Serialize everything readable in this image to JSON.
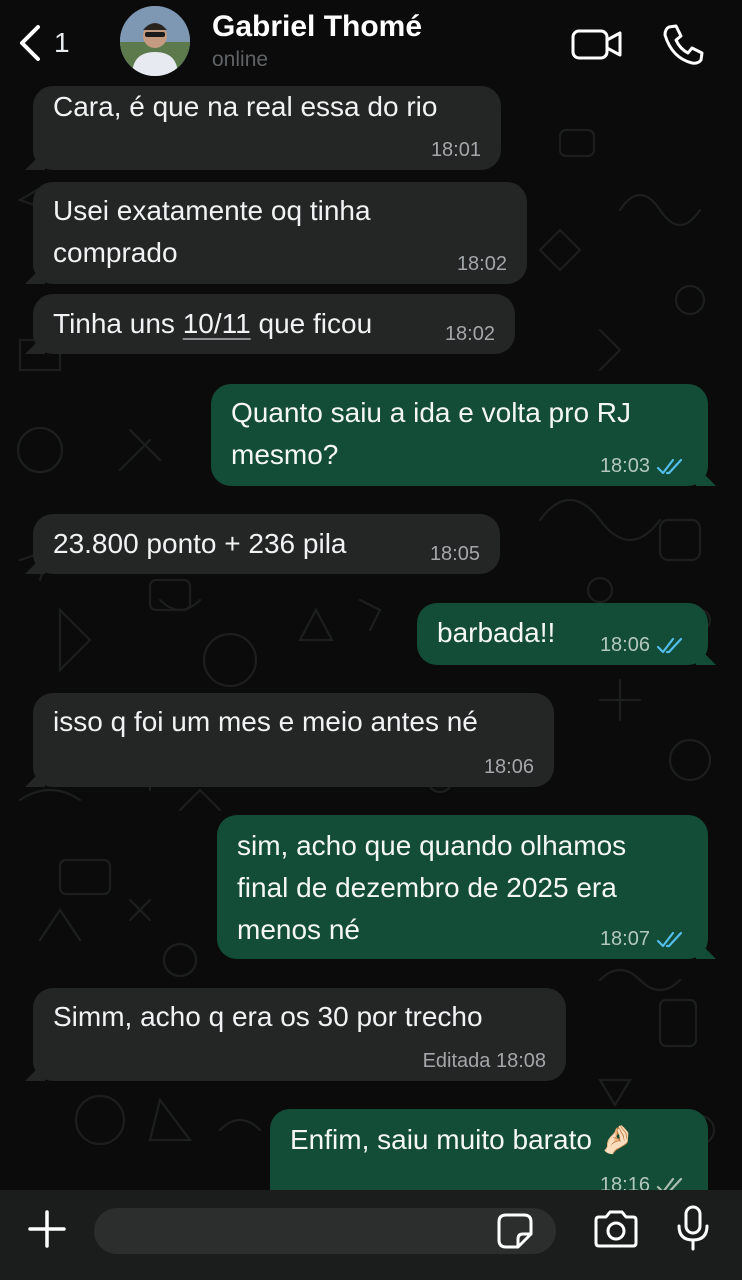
{
  "header": {
    "back_count": "1",
    "contact_name": "Gabriel Thomé",
    "status": "online"
  },
  "messages": [
    {
      "direction": "in",
      "text": "Cara, é que na real essa do rio",
      "time": "18:01"
    },
    {
      "direction": "in",
      "lines": [
        "Usei exatamente oq tinha",
        "comprado"
      ],
      "time": "18:02"
    },
    {
      "direction": "in",
      "text_before": "Tinha uns ",
      "link": "10/11",
      "text_after": " que ficou",
      "time": "18:02"
    },
    {
      "direction": "out",
      "lines": [
        "Quanto saiu a ida e volta pro RJ",
        "mesmo?"
      ],
      "time": "18:03",
      "read": true
    },
    {
      "direction": "in",
      "text": "23.800 ponto + 236 pila",
      "time": "18:05"
    },
    {
      "direction": "out",
      "text": "barbada!!",
      "time": "18:06",
      "read": true
    },
    {
      "direction": "in",
      "text": "isso q foi um mes e meio antes né",
      "time": "18:06"
    },
    {
      "direction": "out",
      "lines": [
        "sim, acho que quando olhamos",
        "final de dezembro de 2025 era",
        "menos né"
      ],
      "time": "18:07",
      "read": true
    },
    {
      "direction": "in",
      "text": "Simm, acho q era os 30 por trecho",
      "time": "Editada 18:08"
    },
    {
      "direction": "out",
      "text": "Enfim, saiu muito barato",
      "emoji": "🤌🏻",
      "time": "18:16",
      "read": true
    }
  ],
  "composer": {
    "value": "",
    "placeholder": ""
  },
  "icons": {
    "back": "chevron-left-icon",
    "video": "video-camera-icon",
    "call": "phone-icon",
    "attach": "plus-icon",
    "sticker": "sticker-icon",
    "camera": "camera-icon",
    "mic": "microphone-icon"
  },
  "colors": {
    "background": "#0b0b0b",
    "incoming_bubble": "#242626",
    "outgoing_bubble": "#144d37",
    "read_ticks": "#53bdeb",
    "footer": "#1b1c1c"
  }
}
